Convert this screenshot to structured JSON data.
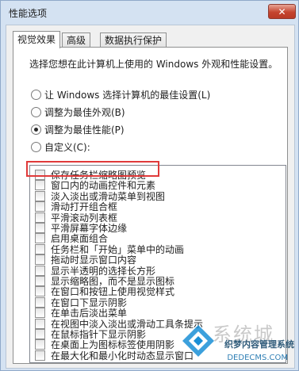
{
  "window": {
    "title": "性能选项",
    "close_label": "✕"
  },
  "tabs": [
    {
      "label": "视觉效果",
      "active": true
    },
    {
      "label": "高级",
      "active": false
    },
    {
      "label": "数据执行保护",
      "active": false
    }
  ],
  "description": "选择您想在此计算机上使用的 Windows 外观和性能设置。",
  "radios": [
    {
      "label": "让 Windows 选择计算机的最佳设置(L)",
      "selected": false
    },
    {
      "label": "调整为最佳外观(B)",
      "selected": false
    },
    {
      "label": "调整为最佳性能(P)",
      "selected": true
    },
    {
      "label": "自定义(C):",
      "selected": false
    }
  ],
  "options": [
    {
      "label": "保存任务栏缩略图预览",
      "checked": false
    },
    {
      "label": "窗口内的动画控件和元素",
      "checked": false
    },
    {
      "label": "淡入淡出或滑动菜单到视图",
      "checked": false
    },
    {
      "label": "滑动打开组合框",
      "checked": false
    },
    {
      "label": "平滑滚动列表框",
      "checked": false
    },
    {
      "label": "平滑屏幕字体边缘",
      "checked": false
    },
    {
      "label": "启用桌面组合",
      "checked": false
    },
    {
      "label": "任务栏和「开始」菜单中的动画",
      "checked": false
    },
    {
      "label": "拖动时显示窗口内容",
      "checked": false
    },
    {
      "label": "显示半透明的选择长方形",
      "checked": false
    },
    {
      "label": "显示缩略图，而不是显示图标",
      "checked": false
    },
    {
      "label": "在窗口和按钮上使用视觉样式",
      "checked": false
    },
    {
      "label": "在窗口下显示阴影",
      "checked": false
    },
    {
      "label": "在单击后淡出菜单",
      "checked": false
    },
    {
      "label": "在视图中淡入淡出或滑动工具条提示",
      "checked": false
    },
    {
      "label": "在鼠标指针下显示阴影",
      "checked": false
    },
    {
      "label": "在桌面上为图标标签使用阴影",
      "checked": false
    },
    {
      "label": "在最大化和最小化时动态显示窗口",
      "checked": false
    }
  ],
  "watermark": {
    "brand": "系统城",
    "text": "织梦内容管理系统",
    "url": "DEDECMS.COM",
    "sub": "xitongcheng.com"
  },
  "colors": {
    "highlight": "#e03a3a",
    "title_bar": "#d4e2f2"
  }
}
